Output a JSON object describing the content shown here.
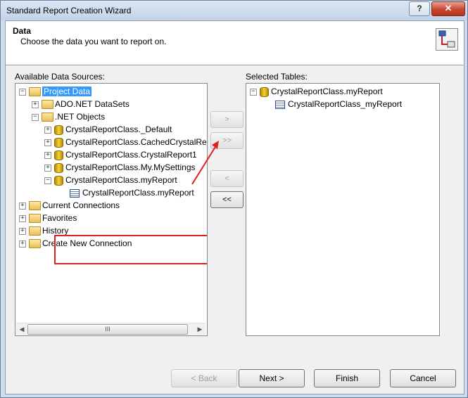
{
  "window": {
    "title": "Standard Report Creation Wizard",
    "help_label": "?",
    "close_label": "✕"
  },
  "header": {
    "title": "Data",
    "subtitle": "Choose the data you want to report on."
  },
  "left": {
    "label": "Available Data Sources:",
    "tree": {
      "project_data": "Project Data",
      "ado_datasets": "ADO.NET DataSets",
      "net_objects": ".NET Objects",
      "default_class": "CrystalReportClass._Default",
      "cached_class": "CrystalReportClass.CachedCrystalRe",
      "report1_class": "CrystalReportClass.CrystalReport1",
      "settings_class": "CrystalReportClass.My.MySettings",
      "myreport_class": "CrystalReportClass.myReport",
      "myreport_child": "CrystalReportClass.myReport",
      "current_connections": "Current Connections",
      "favorites": "Favorites",
      "history": "History",
      "create_new": "Create New Connection"
    },
    "scroll_thumb": "III"
  },
  "middle": {
    "add_one": ">",
    "add_all": ">>",
    "remove_one": "<",
    "remove_all": "<<"
  },
  "right": {
    "label": "Selected Tables:",
    "tree": {
      "root": "CrystalReportClass.myReport",
      "child": "CrystalReportClass_myReport"
    }
  },
  "footer": {
    "back": "< Back",
    "next": "Next >",
    "finish": "Finish",
    "cancel": "Cancel"
  },
  "colors": {
    "selection": "#3399ff",
    "annotation": "#e02020"
  },
  "icons": {
    "folder": "folder-icon",
    "database": "database-icon",
    "table": "table-icon",
    "expand": "expand-plus-icon",
    "collapse": "collapse-minus-icon",
    "data_wizard": "data-wizard-icon"
  }
}
